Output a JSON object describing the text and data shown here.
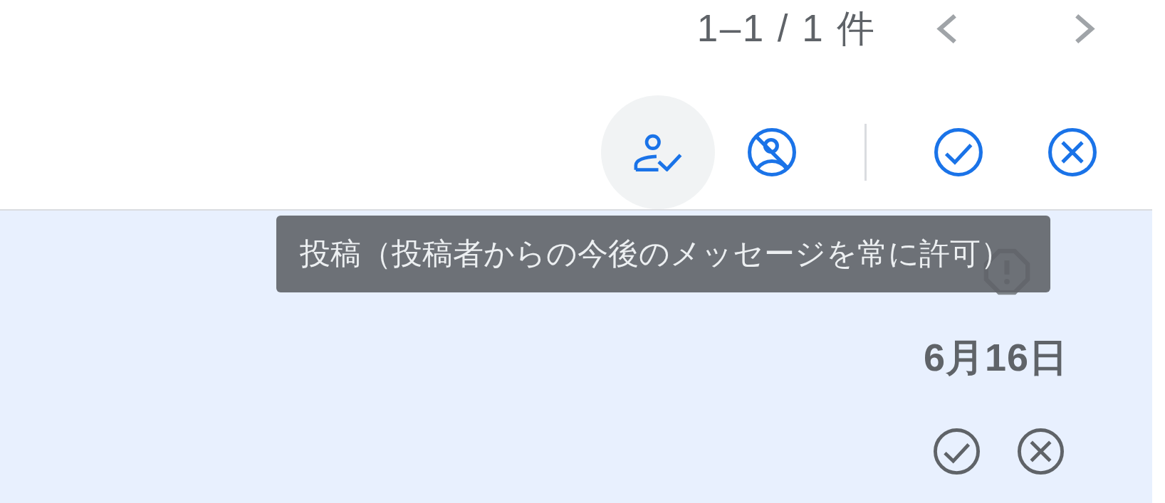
{
  "pagination": {
    "range": "1–1 / 1 件",
    "buttons": [
      {
        "kind": "previous",
        "disabled": true
      },
      {
        "kind": "next",
        "disabled": true
      }
    ]
  },
  "toolbar": {
    "sender_actions": [
      {
        "kind": "allow-sender",
        "hovered": true
      },
      {
        "kind": "block-sender",
        "hovered": false
      }
    ],
    "message_actions": [
      {
        "kind": "approve",
        "hovered": false
      },
      {
        "kind": "reject",
        "hovered": false
      }
    ]
  },
  "tooltip": {
    "text": "投稿（投稿者からの今後のメッセージを常に許可）"
  },
  "messages": [
    {
      "selected": true,
      "warning": true,
      "date": "6月16日",
      "actions": [
        {
          "kind": "approve"
        },
        {
          "kind": "reject"
        }
      ]
    }
  ]
}
